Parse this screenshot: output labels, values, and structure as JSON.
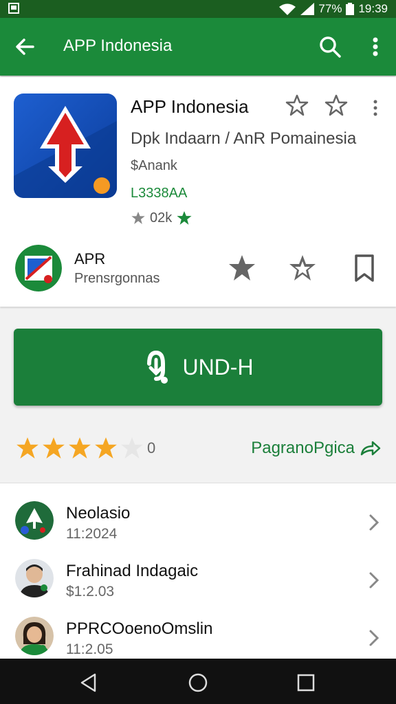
{
  "status": {
    "battery_text": "77%",
    "time": "19:39"
  },
  "appbar": {
    "title": "APP Indonesia"
  },
  "app": {
    "name": "APP Indonesia",
    "description": "Dpk Indaarn / AnR Pomainesia",
    "price": "$Anank",
    "code": "L3338AA",
    "rating_count": "02k"
  },
  "publisher": {
    "name": "APR",
    "subtitle": "Prensrgonnas"
  },
  "install": {
    "label": "UND-H"
  },
  "rating": {
    "stars": 4,
    "max": 5,
    "count": "0"
  },
  "details_link": {
    "label": "PagranoPgica"
  },
  "list": [
    {
      "name": "Neolasio",
      "meta": "11:2024"
    },
    {
      "name": "Frahinad Indagaic",
      "meta": "$1:2.03"
    },
    {
      "name": "PPRCOoenoOmslin",
      "meta": "11:2.05"
    }
  ],
  "colors": {
    "primary": "#1b8a3a",
    "dark": "#1b5e20",
    "star": "#f5a623"
  }
}
